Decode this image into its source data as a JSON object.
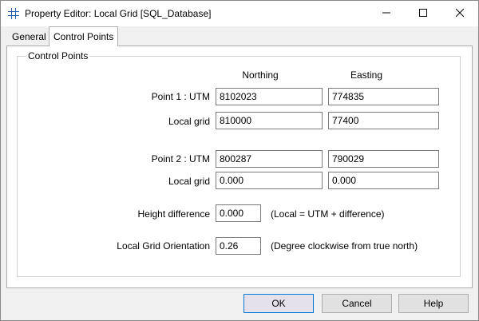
{
  "window": {
    "title": "Property Editor: Local Grid [SQL_Database]",
    "app_icon": "grid-icon"
  },
  "tabs": [
    {
      "label": "General",
      "active": false
    },
    {
      "label": "Control Points",
      "active": true
    }
  ],
  "group": {
    "legend": "Control Points",
    "columns": {
      "northing": "Northing",
      "easting": "Easting"
    },
    "point1": {
      "label_utm": "Point 1 : UTM",
      "label_local": "Local grid",
      "utm_northing": "8102023",
      "utm_easting": "774835",
      "local_northing": "810000",
      "local_easting": "77400"
    },
    "point2": {
      "label_utm": "Point 2 : UTM",
      "label_local": "Local grid",
      "utm_northing": "800287",
      "utm_easting": "790029",
      "local_northing": "0.000",
      "local_easting": "0.000"
    },
    "height_difference": {
      "label": "Height difference",
      "value": "0.000",
      "hint": "(Local = UTM + difference)"
    },
    "orientation": {
      "label": "Local Grid Orientation",
      "value": "0.26",
      "hint": "(Degree clockwise from true north)"
    }
  },
  "buttons": {
    "ok": "OK",
    "cancel": "Cancel",
    "help": "Help"
  },
  "colors": {
    "window_bg": "#f0f0f0",
    "panel_bg": "#ffffff",
    "default_button_border": "#0078d7"
  }
}
